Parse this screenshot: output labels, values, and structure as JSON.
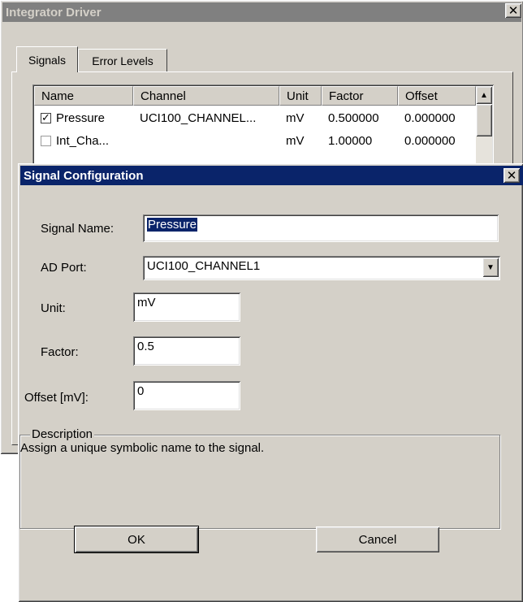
{
  "background_window": {
    "title": "Integrator Driver",
    "close_glyph": "✕",
    "tabs": [
      {
        "label": "Signals",
        "active": true
      },
      {
        "label": "Error Levels",
        "active": false
      }
    ],
    "list": {
      "columns": [
        "Name",
        "Channel",
        "Unit",
        "Factor",
        "Offset"
      ],
      "rows": [
        {
          "checked": true,
          "name": "Pressure",
          "channel": "UCI100_CHANNEL...",
          "unit": "mV",
          "factor": "0.500000",
          "offset": "0.000000"
        },
        {
          "checked": false,
          "name": "Int_Cha...",
          "channel": "",
          "unit": "mV",
          "factor": "1.00000",
          "offset": "0.000000"
        }
      ]
    }
  },
  "dialog": {
    "title": "Signal Configuration",
    "close_glyph": "✕",
    "fields": {
      "signal_name": {
        "label": "Signal Name:",
        "value": "Pressure"
      },
      "ad_port": {
        "label": "AD Port:",
        "value": "UCI100_CHANNEL1"
      },
      "unit": {
        "label": "Unit:",
        "value": "mV"
      },
      "factor": {
        "label": "Factor:",
        "value": "0.5"
      },
      "offset": {
        "label": "Offset [mV]:",
        "value": "0"
      }
    },
    "description": {
      "legend": "Description",
      "text": "Assign a unique symbolic name to the signal."
    },
    "buttons": {
      "ok": "OK",
      "cancel": "Cancel"
    }
  },
  "colors": {
    "face": "#d4d0c8",
    "active_title": "#0a246a",
    "inactive_title": "#808080"
  }
}
